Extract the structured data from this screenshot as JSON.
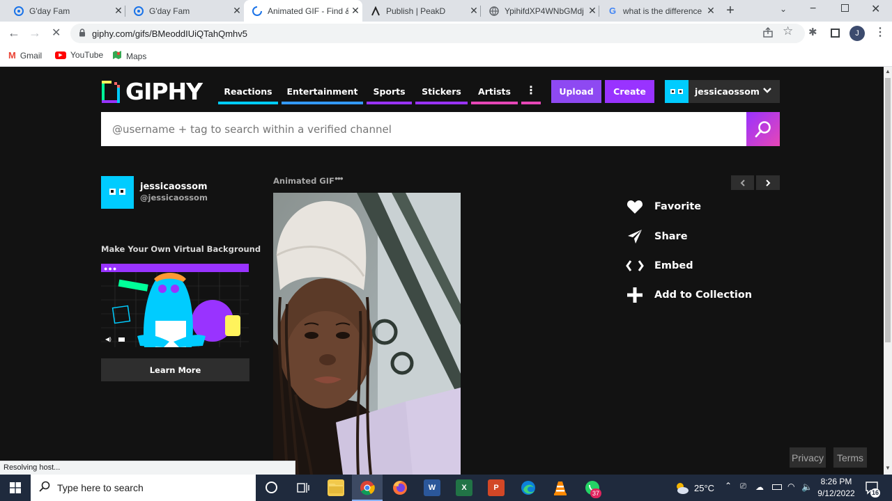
{
  "browser": {
    "tabs": [
      {
        "title": "G'day Fam",
        "favicon": "hive-icon"
      },
      {
        "title": "G'day Fam",
        "favicon": "hive-icon"
      },
      {
        "title": "Animated GIF - Find &",
        "favicon": "loading-icon"
      },
      {
        "title": "Publish | PeakD",
        "favicon": "peakd-icon"
      },
      {
        "title": "YpihifdXP4WNbGMdj",
        "favicon": "globe-icon"
      },
      {
        "title": "what is the difference",
        "favicon": "google-icon"
      }
    ],
    "url": "giphy.com/gifs/BMeoddIUiQTahQmhv5",
    "bookmarks": [
      "Gmail",
      "YouTube",
      "Maps"
    ],
    "status_text": "Resolving host..."
  },
  "giphy": {
    "logo_text": "GIPHY",
    "nav": [
      {
        "label": "Reactions",
        "color": "#00ccff"
      },
      {
        "label": "Entertainment",
        "color": "#3399ff"
      },
      {
        "label": "Sports",
        "color": "#9933ff"
      },
      {
        "label": "Stickers",
        "color": "#9933ff"
      },
      {
        "label": "Artists",
        "color": "#e646b6"
      }
    ],
    "more_color": "#e646b6",
    "upload_label": "Upload",
    "create_label": "Create",
    "username": "jessicaossom",
    "search_placeholder": "@username + tag to search within a verified channel",
    "channel": {
      "name": "jessicaossom",
      "handle": "@jessicaossom"
    },
    "ad": {
      "title": "Make Your Own Virtual Background",
      "cta": "Learn More"
    },
    "gif_label": "Animated GIF",
    "actions": [
      "Favorite",
      "Share",
      "Embed",
      "Add to Collection"
    ],
    "footer": {
      "privacy": "Privacy",
      "terms": "Terms"
    }
  },
  "taskbar": {
    "search_placeholder": "Type here to search",
    "temperature": "25°C",
    "time": "8:26 PM",
    "date": "9/12/2022",
    "notifications": "16",
    "whatsapp_badge": "37"
  }
}
